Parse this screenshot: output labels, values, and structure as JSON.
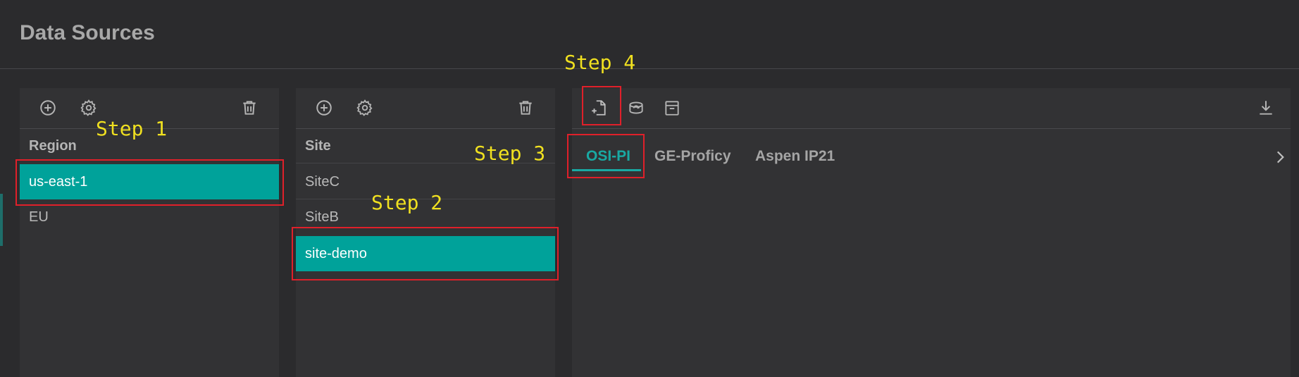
{
  "page": {
    "title": "Data Sources"
  },
  "region_panel": {
    "header": "Region",
    "items": [
      {
        "label": "us-east-1",
        "selected": true
      },
      {
        "label": "EU",
        "selected": false
      }
    ],
    "icons": [
      "add-icon",
      "gear-icon",
      "trash-icon"
    ]
  },
  "site_panel": {
    "header": "Site",
    "items": [
      {
        "label": "SiteC",
        "selected": false
      },
      {
        "label": "SiteB",
        "selected": false
      },
      {
        "label": "site-demo",
        "selected": true
      }
    ],
    "icons": [
      "add-icon",
      "gear-icon",
      "trash-icon"
    ]
  },
  "source_panel": {
    "toolbar_icons": [
      "new-file-icon",
      "database-refresh-icon",
      "archive-icon",
      "download-icon"
    ],
    "tabs": [
      {
        "label": "OSI-PI",
        "active": true
      },
      {
        "label": "GE-Proficy",
        "active": false
      },
      {
        "label": "Aspen IP21",
        "active": false
      }
    ],
    "scroll_icon": "chevron-right-icon"
  },
  "annotations": {
    "step1": "Step 1",
    "step2": "Step 2",
    "step3": "Step 3",
    "step4": "Step 4"
  },
  "colors": {
    "background": "#2b2b2d",
    "panel": "#323234",
    "selection": "#00a29a",
    "active_tab": "#19a9a3",
    "annotation_box": "#e0202a",
    "annotation_text": "#f0e020"
  }
}
